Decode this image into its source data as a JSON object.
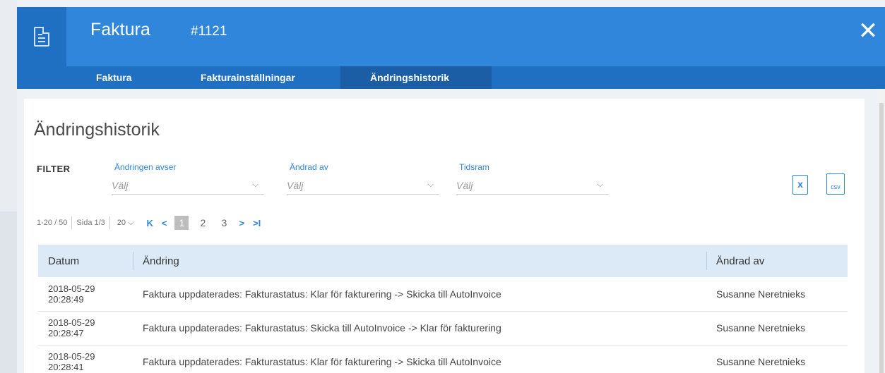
{
  "header": {
    "title": "Faktura",
    "number": "#1121",
    "close_label": "✕"
  },
  "tabs": [
    {
      "label": "Faktura",
      "active": false
    },
    {
      "label": "Fakturainställningar",
      "active": false
    },
    {
      "label": "Ändringshistorik",
      "active": true
    }
  ],
  "main": {
    "title": "Ändringshistorik",
    "filter_label": "FILTER",
    "filters": [
      {
        "label": "Ändringen avser",
        "placeholder": "Välj"
      },
      {
        "label": "Ändrad av",
        "placeholder": "Välj"
      },
      {
        "label": "Tidsram",
        "placeholder": "Välj"
      }
    ],
    "export": {
      "xls_label": "x",
      "csv_label": "csv"
    },
    "pager": {
      "range": "1-20 / 50",
      "page_info": "Sida 1/3",
      "page_size": "20",
      "first": "K",
      "prev": "<",
      "next": ">",
      "last": ">I",
      "pages": [
        "1",
        "2",
        "3"
      ],
      "current_page": "1"
    },
    "table": {
      "headers": [
        "Datum",
        "Ändring",
        "Ändrad av"
      ],
      "rows": [
        {
          "date": "2018-05-29",
          "time": "20:28:49",
          "change": "Faktura uppdaterades: Fakturastatus: Klar för fakturering -> Skicka till AutoInvoice",
          "by": "Susanne Neretnieks"
        },
        {
          "date": "2018-05-29",
          "time": "20:28:47",
          "change": "Faktura uppdaterades: Fakturastatus: Skicka till AutoInvoice -> Klar för fakturering",
          "by": "Susanne Neretnieks"
        },
        {
          "date": "2018-05-29",
          "time": "20:28:41",
          "change": "Faktura uppdaterades: Fakturastatus: Klar för fakturering -> Skicka till AutoInvoice",
          "by": "Susanne Neretnieks"
        }
      ]
    }
  },
  "colors": {
    "header_blue": "#2f86da",
    "tab_bar": "#1f6fc2",
    "active_tab": "#1b5ea6",
    "table_header": "#dceaf7"
  }
}
